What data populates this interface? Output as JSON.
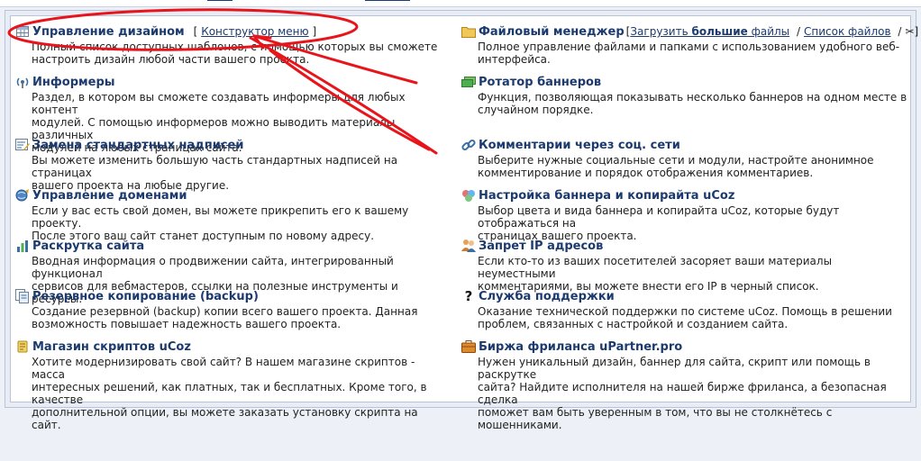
{
  "colors": {
    "link": "#1c3a6e",
    "annotation": "#e8141c",
    "panel_bg": "#ffffff",
    "page_bg": "#edf0f6"
  },
  "left": [
    {
      "id": "design",
      "icon": "grid-icon",
      "title": "Управление дизайном",
      "desc": [
        "Полный список доступных шаблонов, с помощью которых вы сможете",
        "настроить дизайн любой части вашего проекта."
      ],
      "extra": {
        "open": "[",
        "link": "Конструктор меню",
        "close": "]"
      }
    },
    {
      "id": "informers",
      "icon": "broadcast-icon",
      "title": "Информеры",
      "desc": [
        "Раздел, в котором вы сможете создавать информеры для любых контент",
        "модулей. С помощью информеров можно выводить материалы различных",
        "модулей на любых страницах сайта."
      ]
    },
    {
      "id": "labels",
      "icon": "edit-text-icon",
      "title": "Замена стандартных надписей",
      "desc": [
        "Вы можете изменить большую часть стандартных надписей на страницах",
        "вашего проекта на любые другие."
      ]
    },
    {
      "id": "domains",
      "icon": "domain-icon",
      "title": "Управление доменами",
      "desc": [
        "Если у вас есть свой домен, вы можете прикрепить его к вашему проекту.",
        "После этого ваш сайт станет доступным по новому адресу."
      ]
    },
    {
      "id": "promotion",
      "icon": "bar-chart-icon",
      "title": "Раскрутка сайта",
      "desc": [
        "Вводная информация о продвижении сайта, интегрированный функционал",
        "сервисов для вебмастеров, ссылки на полезные инструменты и ресурсы."
      ]
    },
    {
      "id": "backup",
      "icon": "backup-icon",
      "title": "Резервное копирование (backup)",
      "desc": [
        "Создание резервной (backup) копии всего вашего проекта. Данная",
        "возможность повышает надежность вашего проекта."
      ]
    },
    {
      "id": "scripts",
      "icon": "scroll-icon",
      "title": "Магазин скриптов uCoz",
      "desc": [
        "Хотите модернизировать свой сайт? В нашем магазине скриптов - масса",
        "интересных решений, как платных, так и бесплатных. Кроме того, в качестве",
        "дополнительной опции, вы можете заказать установку скрипта на сайт."
      ]
    }
  ],
  "right": [
    {
      "id": "files",
      "icon": "folder-icon",
      "title": "Файловый менеджер",
      "desc": [
        "Полное управление файлами и папками с использованием удобного веб-",
        "интерфейса."
      ],
      "extra": {
        "open": "[",
        "link1_pre": "Загрузить ",
        "link1_bold": "большие",
        "link1_post": " файлы",
        "sep1": "/",
        "link2": "Список файлов",
        "sep2": "/",
        "scissors": "✂",
        "close": "]"
      }
    },
    {
      "id": "banners",
      "icon": "banner-icon",
      "title": "Ротатор баннеров",
      "desc": [
        "Функция, позволяющая показывать несколько баннеров на одном месте в",
        "случайном порядке."
      ]
    },
    {
      "id": "social",
      "icon": "link-icon",
      "title": "Комментарии через соц. сети",
      "desc": [
        "Выберите нужные социальные сети и модули, настройте анонимное",
        "комментирование и порядок отображения комментариев."
      ]
    },
    {
      "id": "copyright",
      "icon": "palette-icon",
      "title": "Настройка баннера и копирайта uCoz",
      "desc": [
        "Выбор цвета и вида баннера и копирайта uCoz, которые будут отображаться на",
        "страницах вашего проекта."
      ]
    },
    {
      "id": "ipban",
      "icon": "users-ban-icon",
      "title": "Запрет IP адресов",
      "desc": [
        "Если кто-то из ваших посетителей засоряет ваши материалы неуместными",
        "комментариями, вы можете внести его IP в черный список."
      ]
    },
    {
      "id": "support",
      "icon": "question-icon",
      "icon_char": "?",
      "title": "Служба поддержки",
      "desc": [
        "Оказание технической поддержки по системе uCoz. Помощь в решении",
        "проблем, связанных с настройкой и созданием сайта."
      ]
    },
    {
      "id": "freelance",
      "icon": "briefcase-icon",
      "title": "Биржа фриланса uPartner.pro",
      "desc": [
        "Нужен уникальный дизайн, баннер для сайта, скрипт или помощь в раскрутке",
        "сайта? Найдите исполнителя на нашей бирже фриланса, а безопасная сделка",
        "поможет вам быть уверенным в том, что вы не столкнётесь с мошенниками."
      ]
    }
  ]
}
